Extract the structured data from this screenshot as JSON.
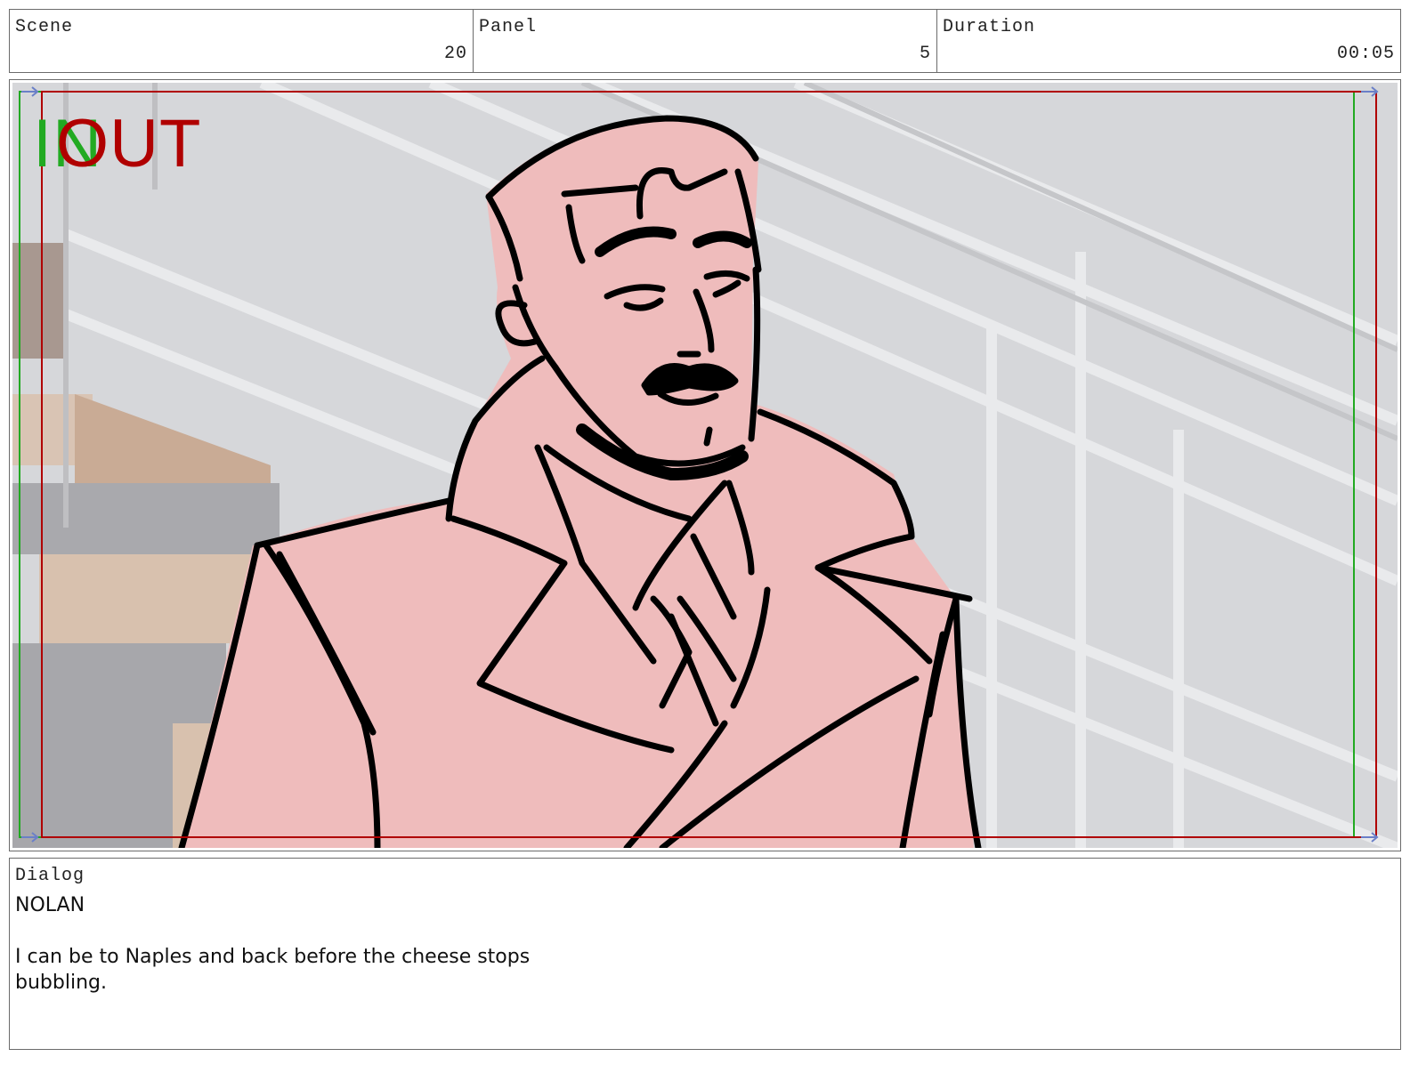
{
  "header": {
    "scene": {
      "label": "Scene",
      "value": "20"
    },
    "panel": {
      "label": "Panel",
      "value": "5"
    },
    "duration": {
      "label": "Duration",
      "value": "00:05"
    }
  },
  "frame": {
    "in_marker": "IN",
    "out_marker": "OUT",
    "colors": {
      "in": "#22aa22",
      "out": "#b00000",
      "character_fill": "#efbcbc",
      "background": "#d6d7da"
    }
  },
  "dialog": {
    "label": "Dialog",
    "character": "NOLAN",
    "line": "I can be to Naples and back before the cheese stops\nbubbling."
  }
}
